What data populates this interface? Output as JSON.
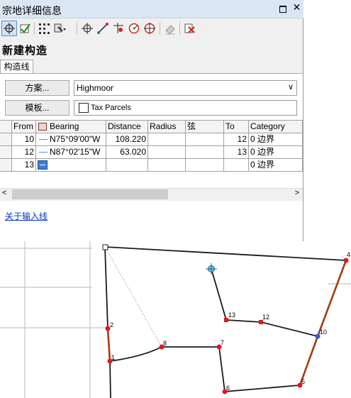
{
  "window": {
    "title": "宗地详细信息",
    "restore_glyph": "",
    "close_glyph": "✕"
  },
  "toolbar": {
    "tools": [
      "select-target-icon",
      "check-icon",
      "grid-points-icon",
      "tools-dropdown-icon",
      "crosshair-icon",
      "line-icon",
      "point-tool-icon",
      "circle-tool-icon",
      "circle-target-icon",
      "eraser-icon",
      "delete-icon"
    ]
  },
  "heading": "新建构造",
  "tab": {
    "label": "构造线"
  },
  "scheme": {
    "button_label": "方案...",
    "selected": "Highmoor",
    "chevron": "∨"
  },
  "template": {
    "button_label": "模板...",
    "layer": "Tax Parcels"
  },
  "grid": {
    "columns": [
      "From",
      "Bearing",
      "Distance",
      "Radius",
      "弦",
      "To",
      "Category"
    ],
    "rows": [
      {
        "from": "10",
        "bearing": "N75°09'00\"W",
        "distance": "108.220",
        "radius": "",
        "chord": "",
        "to": "12",
        "category": "0 边界"
      },
      {
        "from": "12",
        "bearing": "N87°02'15\"W",
        "distance": "63.020",
        "radius": "",
        "chord": "",
        "to": "13",
        "category": "0 边界"
      },
      {
        "from": "13",
        "bearing": "",
        "distance": "",
        "radius": "",
        "chord": "",
        "to": "",
        "category": "0 边界"
      }
    ],
    "scroll_left": "<",
    "scroll_right": ">"
  },
  "link_about": "关于输入线",
  "map": {
    "point_labels": [
      "1",
      "2",
      "4",
      "5",
      "6",
      "7",
      "8",
      "10",
      "12",
      "13"
    ],
    "colors": {
      "boundary": "#1a1a1a",
      "highlight": "#a83a0f",
      "point": "#e01919",
      "point_10": "#2b5fd9"
    }
  }
}
